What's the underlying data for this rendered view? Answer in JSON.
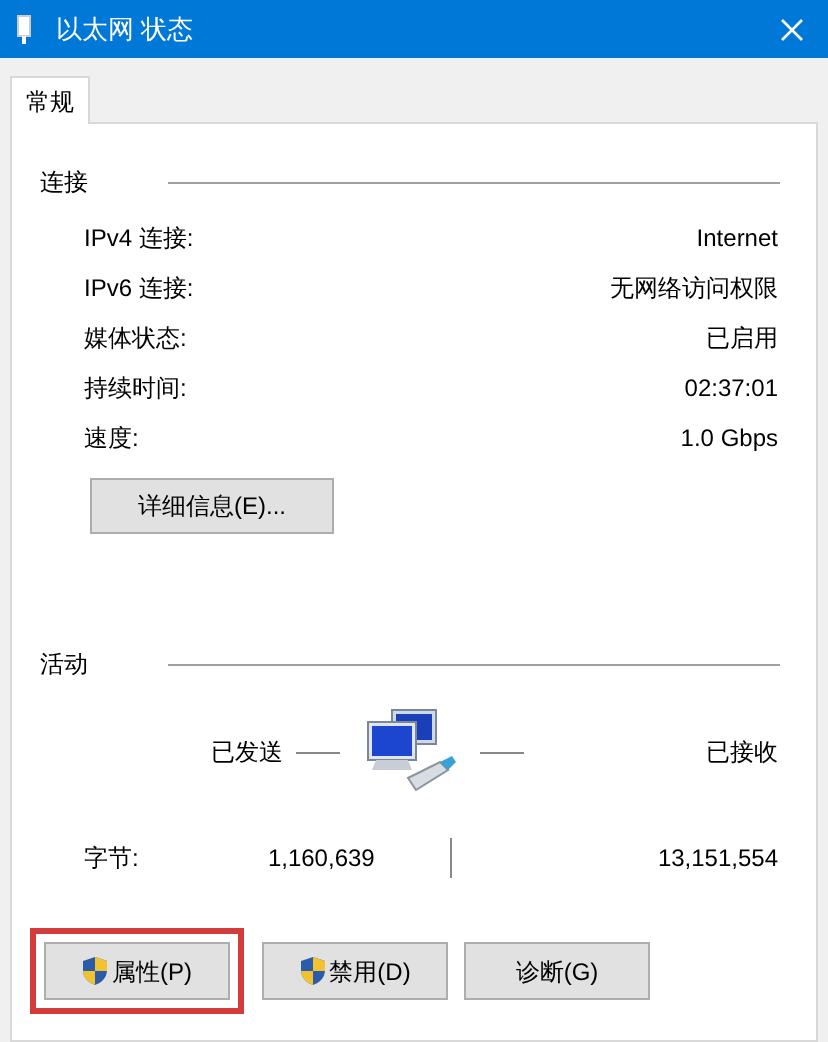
{
  "window": {
    "title": "以太网 状态"
  },
  "tabs": [
    {
      "label": "常规",
      "selected": true
    }
  ],
  "connection": {
    "heading": "连接",
    "rows": [
      {
        "label": "IPv4 连接:",
        "value": "Internet"
      },
      {
        "label": "IPv6 连接:",
        "value": "无网络访问权限"
      },
      {
        "label": "媒体状态:",
        "value": "已启用"
      },
      {
        "label": "持续时间:",
        "value": "02:37:01"
      },
      {
        "label": "速度:",
        "value": "1.0 Gbps"
      }
    ],
    "details_button": "详细信息(E)..."
  },
  "activity": {
    "heading": "活动",
    "sent_label": "已发送",
    "received_label": "已接收",
    "bytes_label": "字节:",
    "bytes_sent": "1,160,639",
    "bytes_received": "13,151,554"
  },
  "buttons": [
    {
      "label": "属性(P)",
      "shield": true,
      "highlighted": true
    },
    {
      "label": "禁用(D)",
      "shield": true,
      "highlighted": false
    },
    {
      "label": "诊断(G)",
      "shield": false,
      "highlighted": false
    }
  ]
}
